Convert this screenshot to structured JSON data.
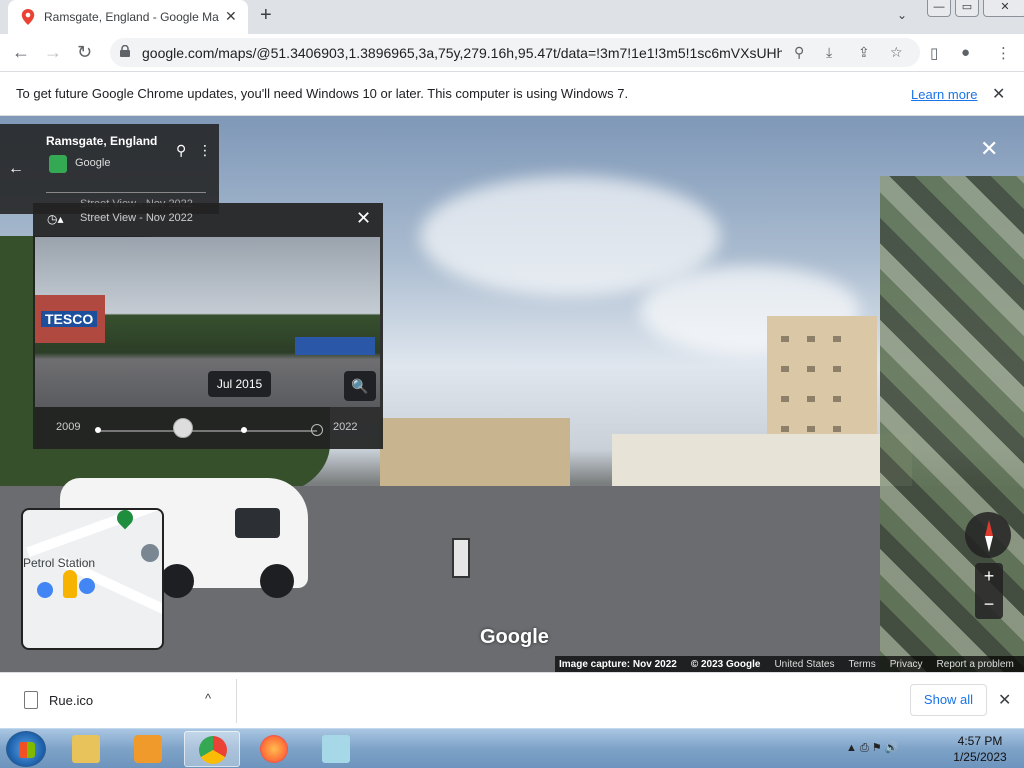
{
  "browser": {
    "tab_title": "Ramsgate, England - Google Ma",
    "tab_close": "✕",
    "new_tab": "+",
    "url": "google.com/maps/@51.3406903,1.3896965,3a,75y,279.16h,95.47t/data=!3m7!1e1!3m5!1sc6mVXsUHh...",
    "window_buttons": {
      "minimize": "—",
      "maximize": "▭",
      "close": "✕"
    }
  },
  "infobar": {
    "message": "To get future Google Chrome updates, you'll need Windows 10 or later. This computer is using Windows 7.",
    "link": "Learn more",
    "close": "✕"
  },
  "place_card": {
    "name": "Ramsgate, England",
    "provider": "Google",
    "street_view_label": "Street View - Nov 2022",
    "back": "←",
    "pin": "⚲",
    "more": "⋮"
  },
  "time_panel": {
    "header": "Street View - Nov 2022",
    "close": "✕",
    "tooltip": "Jul 2015",
    "zoom": "🔍",
    "year_start": "2009",
    "year_end": "2022",
    "preview_sign": "TESCO"
  },
  "minimap": {
    "label": "Petrol Station",
    "edge_letter": "e"
  },
  "street_view": {
    "close": "✕",
    "logo": "Google",
    "zoom_in": "+",
    "zoom_out": "−",
    "footer": {
      "capture": "Image capture: Nov 2022",
      "copyright": "© 2023 Google",
      "country": "United States",
      "terms": "Terms",
      "privacy": "Privacy",
      "report": "Report a problem"
    }
  },
  "downloads": {
    "file": "Rue.ico",
    "chevron": "^",
    "show_all": "Show all",
    "close": "✕"
  },
  "taskbar": {
    "time": "4:57 PM",
    "date": "1/25/2023",
    "tray": "▲ ⎙ ⚑ 🔊"
  },
  "colors": {
    "accent": "#1a73e8",
    "compass_red": "#e03b2f",
    "taskbar": "#7ea3c8"
  }
}
